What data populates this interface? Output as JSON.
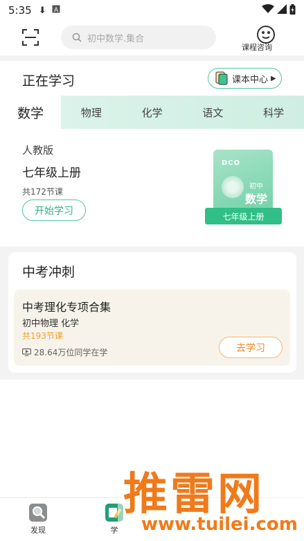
{
  "status_bar": {
    "time": "5:35",
    "icons": [
      "download-icon",
      "a-icon",
      "wifi-icon",
      "signal-icon",
      "battery-icon"
    ]
  },
  "topbar": {
    "search_placeholder": "初中数学.集合",
    "consult_label": "课程咨询"
  },
  "learning": {
    "title": "正在学习",
    "book_center_label": "课本中心",
    "tabs": [
      {
        "label": "数学",
        "active": true
      },
      {
        "label": "物理",
        "active": false
      },
      {
        "label": "化学",
        "active": false
      },
      {
        "label": "语文",
        "active": false
      },
      {
        "label": "科学",
        "active": false
      }
    ],
    "edition": "人教版",
    "grade": "七年级上册",
    "lesson_count": "共172节课",
    "start_button": "开始学习",
    "cover": {
      "level": "初中",
      "subject": "数学",
      "ribbon": "七年级上册"
    }
  },
  "sprint": {
    "title": "中考冲刺",
    "card": {
      "name": "中考理化专项合集",
      "subjects": "初中物理   化学",
      "lessons": "共193节课",
      "students": "28.64万位同学在学",
      "go_button": "去学习"
    }
  },
  "bottom_nav": [
    {
      "label": "发现"
    },
    {
      "label": "学"
    }
  ],
  "watermark": {
    "text": "推雷网",
    "url": "www.tuilei.com"
  },
  "colors": {
    "accent": "#2fbf87",
    "orange": "#ef8a26"
  }
}
